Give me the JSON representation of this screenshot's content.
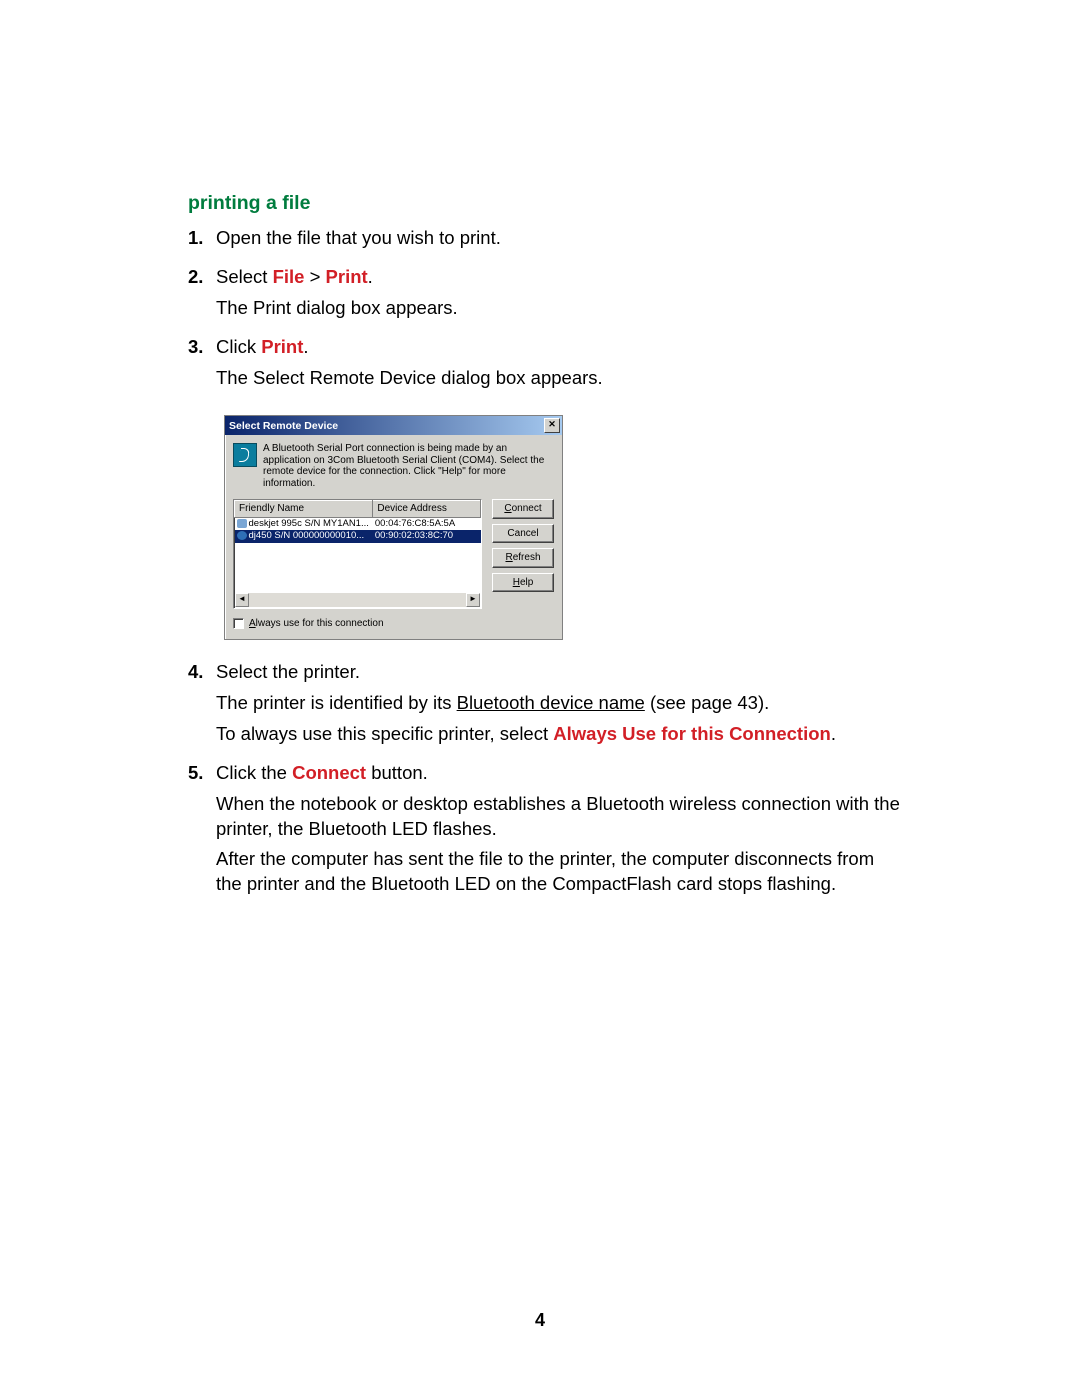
{
  "heading": "printing a file",
  "steps": [
    {
      "num": "1.",
      "lines": [
        {
          "parts": [
            {
              "t": "Open the file that you wish to print."
            }
          ]
        }
      ]
    },
    {
      "num": "2.",
      "lines": [
        {
          "parts": [
            {
              "t": "Select "
            },
            {
              "t": "File",
              "cls": "bold-red"
            },
            {
              "t": " > "
            },
            {
              "t": "Print",
              "cls": "bold-red"
            },
            {
              "t": "."
            }
          ]
        },
        {
          "parts": [
            {
              "t": "The Print dialog box appears."
            }
          ]
        }
      ]
    },
    {
      "num": "3.",
      "lines": [
        {
          "parts": [
            {
              "t": "Click "
            },
            {
              "t": "Print",
              "cls": "bold-red"
            },
            {
              "t": "."
            }
          ]
        },
        {
          "parts": [
            {
              "t": "The Select Remote Device dialog box appears."
            }
          ]
        }
      ]
    },
    {
      "num": "4.",
      "lines": [
        {
          "parts": [
            {
              "t": "Select the printer."
            }
          ]
        },
        {
          "parts": [
            {
              "t": "The printer is identified by its "
            },
            {
              "t": "Bluetooth device name",
              "cls": "underline"
            },
            {
              "t": " (see page 43)."
            }
          ]
        },
        {
          "parts": [
            {
              "t": "To always use this specific printer, select "
            },
            {
              "t": "Always Use for this Connection",
              "cls": "bold-red"
            },
            {
              "t": "."
            }
          ]
        }
      ]
    },
    {
      "num": "5.",
      "lines": [
        {
          "parts": [
            {
              "t": "Click the "
            },
            {
              "t": "Connect",
              "cls": "bold-red"
            },
            {
              "t": " button."
            }
          ]
        },
        {
          "parts": [
            {
              "t": "When the notebook or desktop establishes a Bluetooth wireless connection with the printer, the Bluetooth LED flashes."
            }
          ]
        },
        {
          "parts": [
            {
              "t": "After the computer has sent the file to the printer, the computer disconnects from the printer and the Bluetooth LED on the CompactFlash card stops flashing."
            }
          ]
        }
      ]
    }
  ],
  "dialog": {
    "title": "Select Remote Device",
    "info": "A Bluetooth Serial Port connection is being made by an application on 3Com Bluetooth Serial Client (COM4). Select the remote device for the connection. Click \"Help\" for more information.",
    "columns": {
      "name": "Friendly Name",
      "addr": "Device Address"
    },
    "rows": [
      {
        "name": "deskjet 995c S/N MY1AN1...",
        "addr": "00:04:76:C8:5A:5A",
        "selected": false,
        "icon": "printer"
      },
      {
        "name": "dj450 S/N 000000000010...",
        "addr": "00:90:02:03:8C:70",
        "selected": true,
        "icon": "ball"
      }
    ],
    "buttons": {
      "connect": {
        "pre": "",
        "mn": "C",
        "post": "onnect"
      },
      "cancel": {
        "pre": "",
        "mn": "",
        "post": "Cancel"
      },
      "refresh": {
        "pre": "",
        "mn": "R",
        "post": "efresh"
      },
      "help": {
        "pre": "",
        "mn": "H",
        "post": "elp"
      }
    },
    "checkbox": {
      "pre": "",
      "mn": "A",
      "post": "lways use for this connection"
    },
    "close_glyph": "✕",
    "scroll_left": "◄",
    "scroll_right": "►"
  },
  "page_number": "4"
}
